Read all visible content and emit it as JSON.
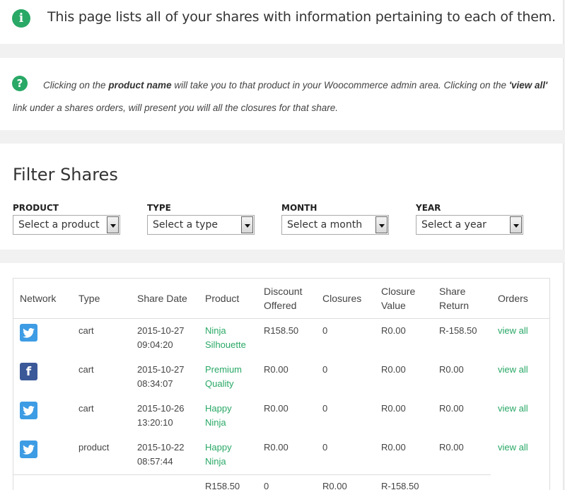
{
  "info": {
    "text": "This page lists all of your shares with information pertaining to each of them."
  },
  "help": {
    "part1": "Clicking on the ",
    "bold1": "product name",
    "part2": " will take you to that product in your Woocommerce admin area. Clicking on the ",
    "bold2": "'view all'",
    "part3": " link under a shares orders, will present you will all the closures for that share."
  },
  "filter": {
    "title": "Filter Shares",
    "product": {
      "label": "PRODUCT",
      "value": "Select a product"
    },
    "type": {
      "label": "TYPE",
      "value": "Select a type"
    },
    "month": {
      "label": "MONTH",
      "value": "Select a month"
    },
    "year": {
      "label": "YEAR",
      "value": "Select a year"
    }
  },
  "table": {
    "headers": {
      "network": "Network",
      "type": "Type",
      "share_date": "Share Date",
      "product": "Product",
      "discount_1": "Discount",
      "discount_2": "Offered",
      "closures": "Closures",
      "closure_value_1": "Closure",
      "closure_value_2": "Value",
      "share_return_1": "Share",
      "share_return_2": "Return",
      "orders": "Orders"
    },
    "rows": [
      {
        "network": "twitter-icon",
        "type": "cart",
        "date": "2015-10-27",
        "time": "09:04:20",
        "product_1": "Ninja",
        "product_2": "Silhouette",
        "discount": "R158.50",
        "closures": "0",
        "closure_value": "R0.00",
        "share_return": "R-158.50",
        "orders": "view all"
      },
      {
        "network": "facebook-icon",
        "type": "cart",
        "date": "2015-10-27",
        "time": "08:34:07",
        "product_1": "Premium",
        "product_2": "Quality",
        "discount": "R0.00",
        "closures": "0",
        "closure_value": "R0.00",
        "share_return": "R0.00",
        "orders": "view all"
      },
      {
        "network": "twitter-icon",
        "type": "cart",
        "date": "2015-10-26",
        "time": "13:20:10",
        "product_1": "Happy",
        "product_2": "Ninja",
        "discount": "R0.00",
        "closures": "0",
        "closure_value": "R0.00",
        "share_return": "R0.00",
        "orders": "view all"
      },
      {
        "network": "twitter-icon",
        "type": "product",
        "date": "2015-10-22",
        "time": "08:57:44",
        "product_1": "Happy",
        "product_2": "Ninja",
        "discount": "R0.00",
        "closures": "0",
        "closure_value": "R0.00",
        "share_return": "R0.00",
        "orders": "view all"
      }
    ],
    "totals": {
      "discount": "R158.50",
      "closures": "0",
      "closure_value": "R0.00",
      "share_return": "R-158.50"
    }
  },
  "colors": {
    "accent": "#29a866",
    "twitter": "#3d9ce4",
    "facebook": "#3b5998"
  }
}
